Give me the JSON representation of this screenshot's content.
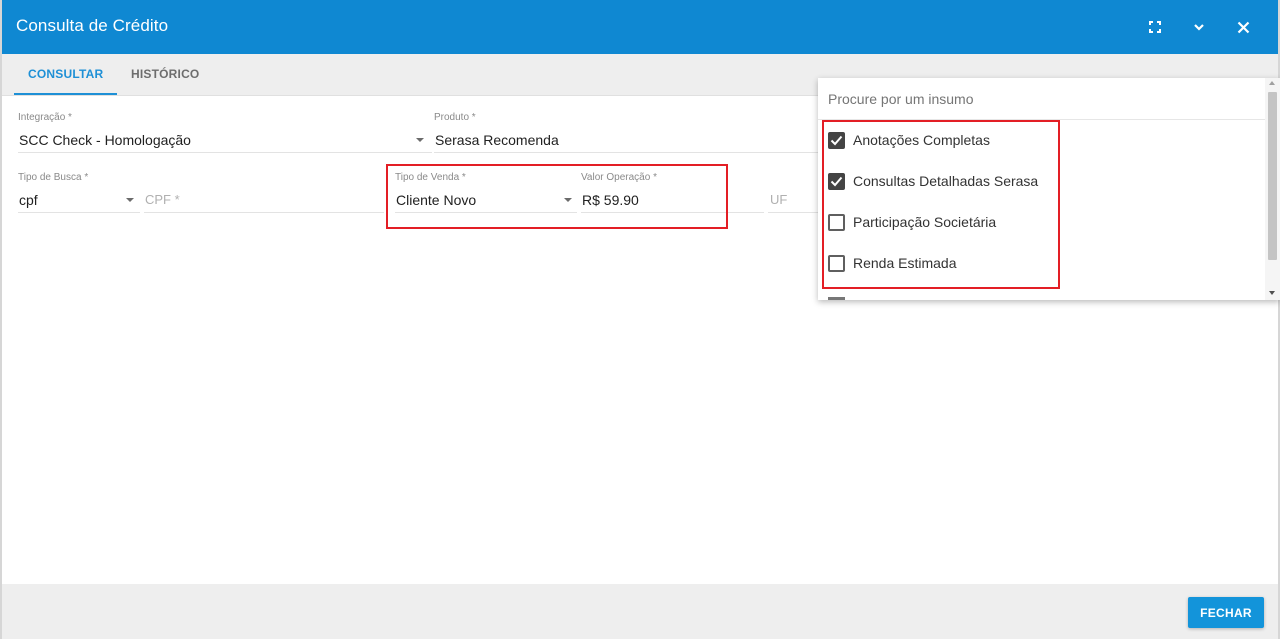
{
  "window": {
    "title": "Consulta de Crédito",
    "controls": [
      "fullscreen-icon",
      "chevron-down-icon",
      "close-icon"
    ]
  },
  "tabs": [
    {
      "label": "CONSULTAR",
      "active": true
    },
    {
      "label": "HISTÓRICO",
      "active": false
    }
  ],
  "form": {
    "integracao": {
      "label": "Integração *",
      "value": "SCC Check - Homologação"
    },
    "produto": {
      "label": "Produto *",
      "value": "Serasa Recomenda"
    },
    "tipo_busca": {
      "label": "Tipo de Busca *",
      "value": "cpf"
    },
    "cpf": {
      "placeholder": "CPF *"
    },
    "tipo_venda": {
      "label": "Tipo de Venda *",
      "value": "Cliente Novo"
    },
    "valor_operacao": {
      "label": "Valor Operação *",
      "value": "R$ 59.90"
    },
    "uf": {
      "placeholder": "UF"
    }
  },
  "dropdown": {
    "search_placeholder": "Procure por um insumo",
    "items": [
      {
        "label": "Anotações Completas",
        "checked": true
      },
      {
        "label": "Consultas Detalhadas Serasa",
        "checked": true
      },
      {
        "label": "Participação Societária",
        "checked": false
      },
      {
        "label": "Renda Estimada",
        "checked": false
      }
    ]
  },
  "footer": {
    "close_label": "FECHAR"
  },
  "colors": {
    "titlebar": "#0f88d2",
    "accent": "#1e90d6",
    "highlight": "#e31e25"
  }
}
